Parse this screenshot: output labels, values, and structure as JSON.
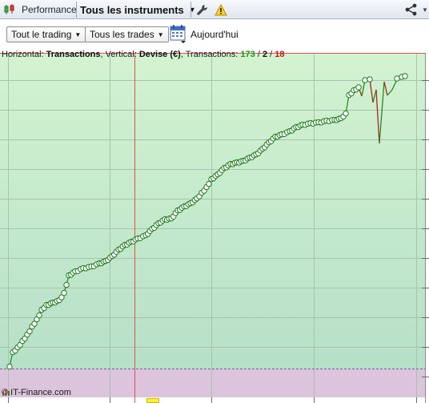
{
  "tabbar": {
    "performance_label": "Performance",
    "instruments_label": "Tous les instruments",
    "icons": [
      "candlestick-chart-icon",
      "wrench-icon",
      "warning-icon",
      "share-icon",
      "chevron-down-icon"
    ]
  },
  "toolbar": {
    "trading_select": "Tout le trading",
    "trades_select": "Tous les trades",
    "today_label": "Aujourd'hui"
  },
  "chart": {
    "horizontal_label": "Horizontal:",
    "horizontal_value": "Transactions",
    "vertical_label": "Vertical:",
    "vertical_value": "Devise (€)",
    "transactions_label": "Transactions:",
    "winning": "173",
    "slash1": " / ",
    "neutral": "2",
    "slash2": " / ",
    "losing": "18",
    "copyright": "© IT-Finance.com",
    "colors": {
      "profit_zone": "#cdefcf",
      "loss_zone": "#dcc4dc",
      "gain_line": "#1f8a1f",
      "loss_line": "#b02020",
      "crosshair": "#e05050",
      "marker": "#ffef3c"
    }
  }
}
